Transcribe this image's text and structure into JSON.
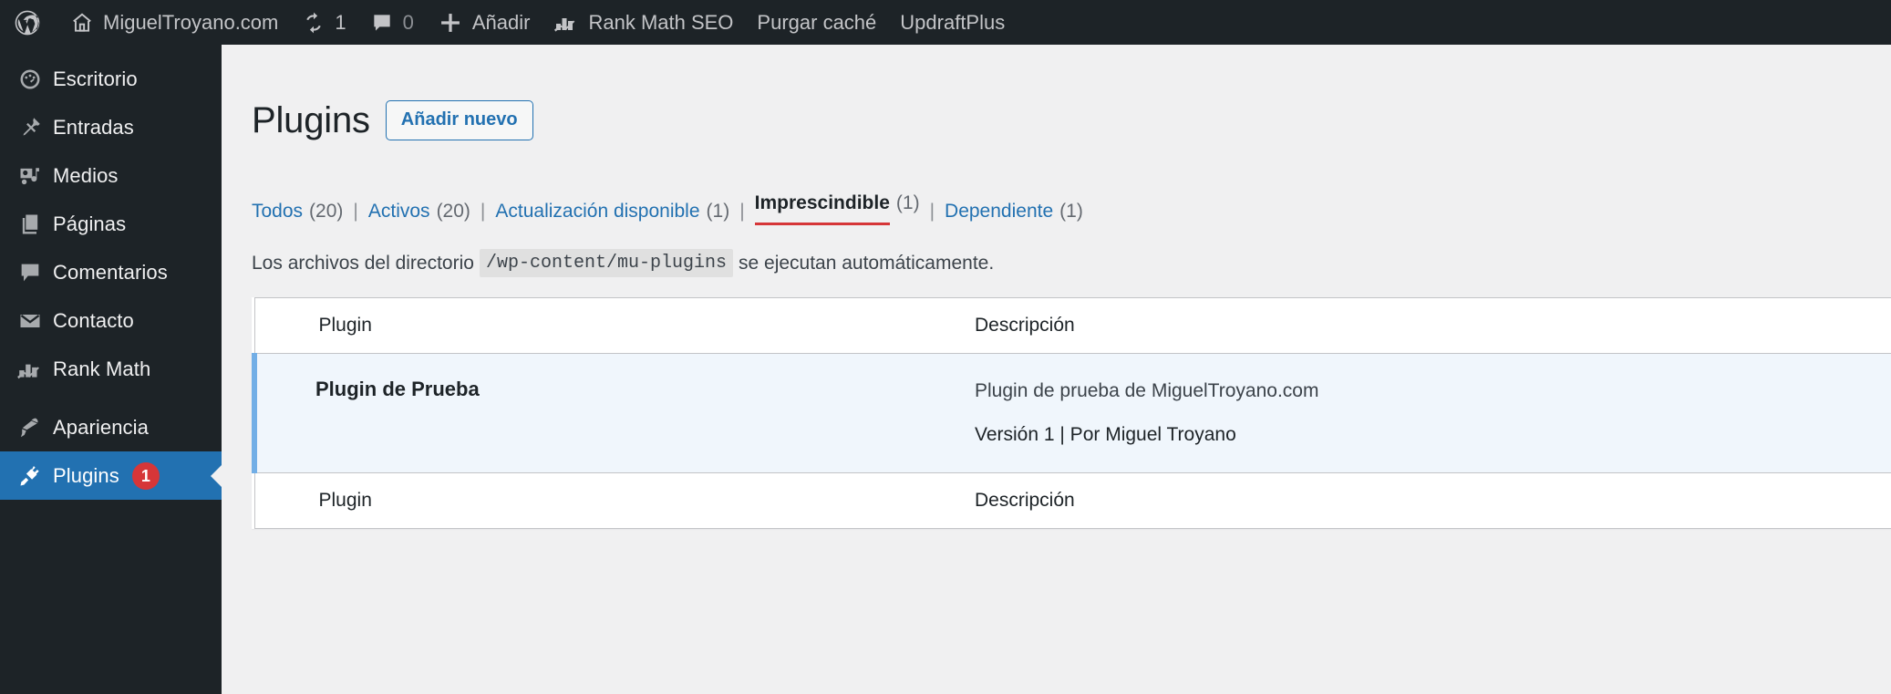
{
  "adminbar": {
    "logo_icon": "wordpress-logo-icon",
    "site": {
      "icon": "home-icon",
      "label": "MiguelTroyano.com"
    },
    "updates": {
      "icon": "updates-icon",
      "count": "1"
    },
    "comments": {
      "icon": "comment-bubble-icon",
      "count": "0"
    },
    "new": {
      "icon": "plus-icon",
      "label": "Añadir"
    },
    "rankmath": {
      "icon": "rank-math-icon",
      "label": "Rank Math SEO"
    },
    "purge": {
      "label": "Purgar caché"
    },
    "updraft": {
      "label": "UpdraftPlus"
    }
  },
  "sidebar": {
    "items": [
      {
        "label": "Escritorio",
        "icon": "dashboard-icon",
        "current": false
      },
      {
        "label": "Entradas",
        "icon": "pin-icon",
        "current": false
      },
      {
        "label": "Medios",
        "icon": "media-icon",
        "current": false
      },
      {
        "label": "Páginas",
        "icon": "pages-icon",
        "current": false
      },
      {
        "label": "Comentarios",
        "icon": "comment-icon",
        "current": false
      },
      {
        "label": "Contacto",
        "icon": "envelope-icon",
        "current": false
      },
      {
        "label": "Rank Math",
        "icon": "rank-math-icon",
        "current": false
      },
      {
        "label": "Apariencia",
        "icon": "brush-icon",
        "current": false
      },
      {
        "label": "Plugins",
        "icon": "plug-icon",
        "current": true,
        "badge": "1"
      }
    ]
  },
  "page": {
    "title": "Plugins",
    "add_new_label": "Añadir nuevo",
    "filters": [
      {
        "label": "Todos",
        "count": "(20)",
        "current": false
      },
      {
        "label": "Activos",
        "count": "(20)",
        "current": false
      },
      {
        "label": "Actualización disponible",
        "count": "(1)",
        "current": false
      },
      {
        "label": "Imprescindible",
        "count": "(1)",
        "current": true
      },
      {
        "label": "Dependiente",
        "count": "(1)",
        "current": false
      }
    ],
    "separator": "|",
    "mu_note": {
      "before": "Los archivos del directorio",
      "code": "/wp-content/mu-plugins",
      "after": "se ejecutan automáticamente."
    },
    "table": {
      "columns": {
        "plugin": "Plugin",
        "description": "Descripción"
      },
      "rows": [
        {
          "name": "Plugin de Prueba",
          "description": "Plugin de prueba de MiguelTroyano.com",
          "meta": "Versión 1 | Por Miguel Troyano"
        }
      ]
    }
  },
  "colors": {
    "admin_bg": "#1d2327",
    "accent_blue": "#2271b1",
    "link_blue": "#2271b1",
    "active_underline": "#d63638",
    "badge_red": "#d63638",
    "row_highlight": "#f0f6fc",
    "row_border": "#72aee6",
    "page_bg": "#f0f0f1"
  }
}
